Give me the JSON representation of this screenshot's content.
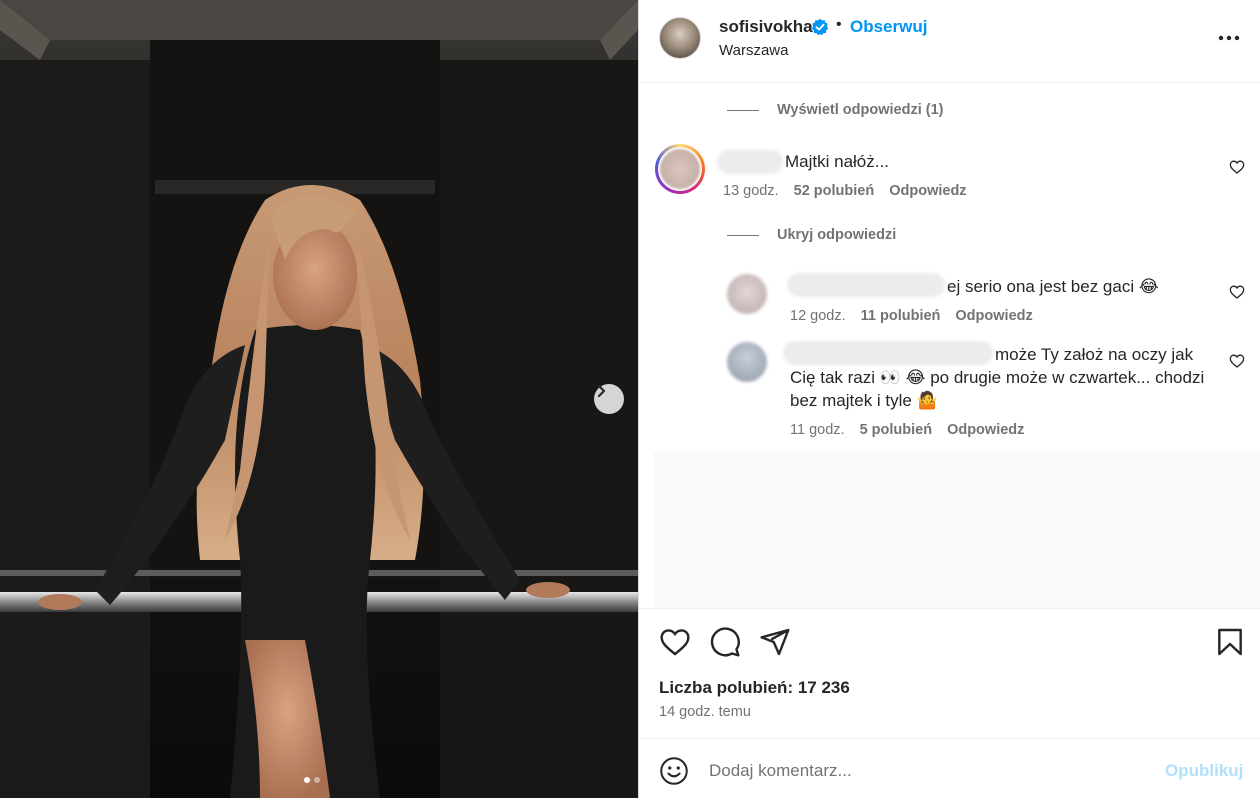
{
  "post": {
    "username": "sofisivokha",
    "verified_icon": "verified-badge-icon",
    "follow_label": "Obserwuj",
    "location": "Warszawa",
    "bullet": "•"
  },
  "comments": {
    "show_replies_1": "Wyświetl odpowiedzi (1)",
    "hide_replies": "Ukryj odpowiedzi",
    "items": [
      {
        "text": "Majtki nałóż...",
        "time": "13 godz.",
        "likes": "52 polubień",
        "reply": "Odpowiedz"
      },
      {
        "text": "ej serio ona jest bez gaci 😂",
        "time": "12 godz.",
        "likes": "11 polubień",
        "reply": "Odpowiedz"
      },
      {
        "text_line1": "może Ty założ na oczy jak",
        "text_line2": "Cię tak razi 👀 😂  po drugie może w czwartek... chodzi",
        "text_line3": "bez majtek i tyle 🤷",
        "time": "11 godz.",
        "likes": "5 polubień",
        "reply": "Odpowiedz"
      }
    ]
  },
  "footer": {
    "likes": "Liczba polubień: 17 236",
    "posted": "14 godz. temu",
    "comment_placeholder": "Dodaj komentarz...",
    "post_label": "Opublikuj"
  },
  "carousel": {
    "current": 1,
    "total": 2
  },
  "colors": {
    "accent": "#0095f6",
    "muted": "#737373",
    "post_disabled": "#b2dffc"
  }
}
